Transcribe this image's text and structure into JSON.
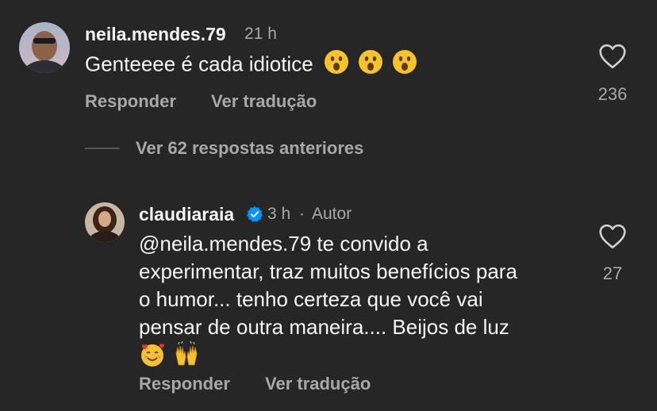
{
  "comment1": {
    "username": "neila.mendes.79",
    "time": "21 h",
    "text": "Genteeee é cada idiotice",
    "emojis": [
      "😮",
      "😮",
      "😮"
    ],
    "reply_label": "Responder",
    "translate_label": "Ver tradução",
    "like_count": "236",
    "liked": false
  },
  "replies_toggle": "Ver 62 respostas anteriores",
  "comment2": {
    "username": "claudiaraia",
    "verified": true,
    "time": "3 h",
    "separator": "·",
    "author_badge": "Autor",
    "mention": "@neila.mendes.79",
    "text_line1": " te convido a",
    "text_line2": "experimentar, traz muitos benefícios para",
    "text_line3": "o humor... tenho certeza que você vai",
    "text_line4": "pensar de outra maneira.... Beijos de luz",
    "emojis": [
      "🥰",
      "🙌"
    ],
    "reply_label": "Responder",
    "translate_label": "Ver tradução",
    "like_count": "27",
    "liked": false
  },
  "icons": {
    "heart": "heart-outline-icon",
    "verified": "verified-badge-icon"
  },
  "colors": {
    "background": "#262626",
    "primary_text": "#f5f5f5",
    "secondary_text": "#a8a8a8",
    "verified_blue": "#0095f6"
  }
}
